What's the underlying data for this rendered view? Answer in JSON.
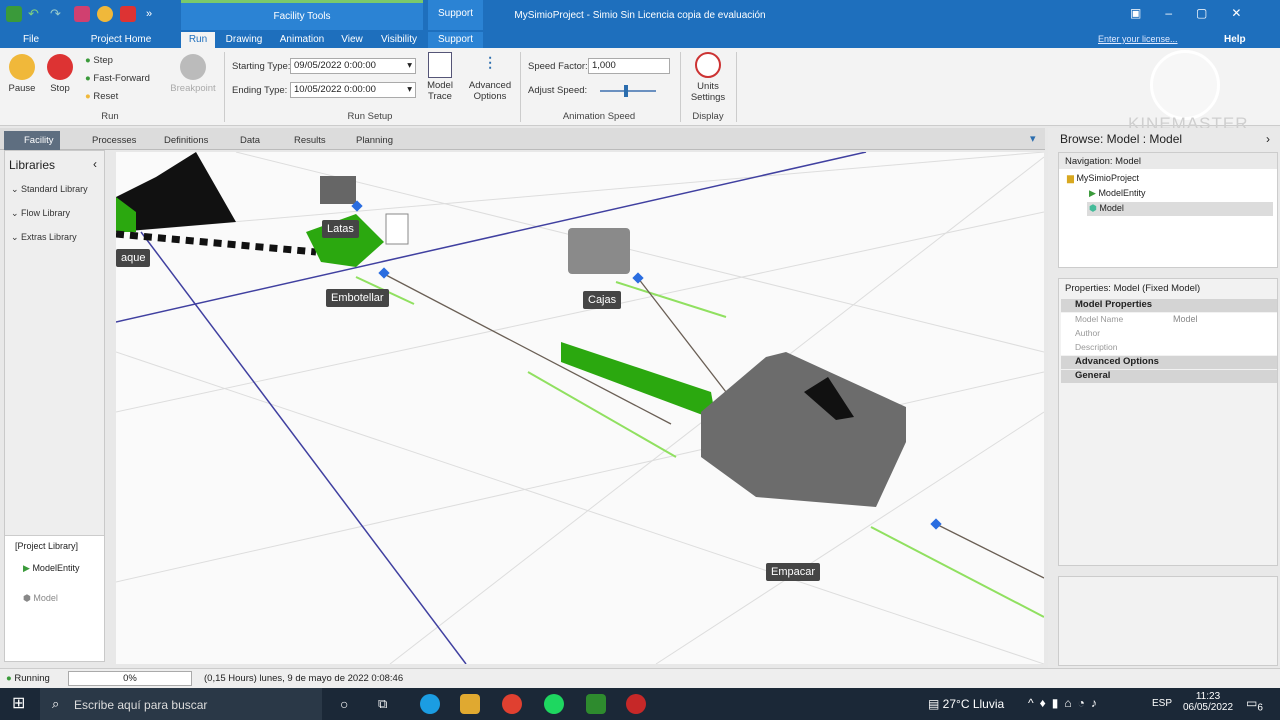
{
  "window": {
    "title": "MySimioProject - Simio Sin Licencia copia de evaluación",
    "context_group": "Facility Tools",
    "support_group": "Support",
    "license_link": "Enter your license...",
    "help": "Help"
  },
  "tabs": [
    "File",
    "Project Home",
    "Run",
    "Drawing",
    "Animation",
    "View",
    "Visibility",
    "Support"
  ],
  "ribbon": {
    "run": {
      "pause": "Pause",
      "stop": "Stop",
      "step": "Step",
      "fast_forward": "Fast-Forward",
      "reset": "Reset",
      "breakpoint": "Breakpoint",
      "group": "Run"
    },
    "setup": {
      "starting_type_label": "Starting Type:",
      "starting_type_value": "09/05/2022 0:00:00",
      "ending_type_label": "Ending Type:",
      "ending_type_value": "10/05/2022 0:00:00",
      "model_trace": "Model Trace",
      "advanced_options": "Advanced Options",
      "group": "Run Setup"
    },
    "animation": {
      "speed_factor_label": "Speed Factor:",
      "speed_factor_value": "1,000",
      "adjust_speed_label": "Adjust Speed:",
      "group": "Animation Speed"
    },
    "display": {
      "units_settings": "Units Settings",
      "group": "Display"
    }
  },
  "view_tabs": [
    "Facility",
    "Processes",
    "Definitions",
    "Data",
    "Results",
    "Planning"
  ],
  "libraries": {
    "title": "Libraries",
    "items": [
      "Standard Library",
      "Flow Library",
      "Extras Library"
    ],
    "project_library": "[Project Library]",
    "project_items": [
      "ModelEntity",
      "Model"
    ]
  },
  "canvas_labels": {
    "latas": "Latas",
    "embotellar": "Embotellar",
    "cajas": "Cajas",
    "empacar": "Empacar",
    "tanque": "aque"
  },
  "browse": {
    "title": "Browse: Model : Model",
    "navigation_header": "Navigation: Model",
    "tree": [
      "MySimioProject",
      "ModelEntity",
      "Model"
    ]
  },
  "properties": {
    "header": "Properties: Model (Fixed Model)",
    "section": "Model Properties",
    "rows": [
      {
        "name": "Model Name",
        "value": "Model"
      },
      {
        "name": "Author",
        "value": ""
      },
      {
        "name": "Description",
        "value": ""
      }
    ],
    "advanced": "Advanced Options",
    "general": "General"
  },
  "status": {
    "state": "Running",
    "progress": "0%",
    "time": "(0,15 Hours) lunes, 9 de mayo de 2022 0:08:46"
  },
  "watermark": "KINEMASTER",
  "taskbar": {
    "search_placeholder": "Escribe aquí para buscar",
    "weather": "27°C  Lluvia",
    "lang": "ESP",
    "time": "11:23",
    "date": "06/05/2022",
    "notif": "6"
  },
  "colors": {
    "accent": "#1e6fbd",
    "green": "#2ba80f",
    "grey_shape": "#707070"
  }
}
